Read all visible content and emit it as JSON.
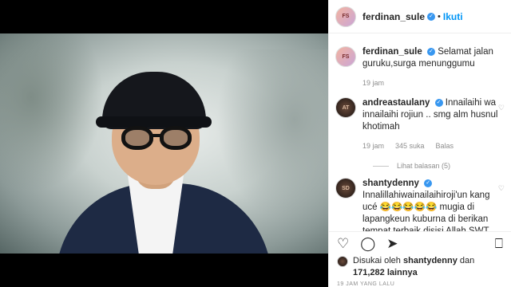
{
  "post_author": {
    "username": "ferdinan_sule",
    "follow_label": "Ikuti",
    "separator": "•",
    "avatar_icon": "avatar-ferdinan-sule"
  },
  "comments": [
    {
      "username": "ferdinan_sule",
      "text": "Selamat jalan guruku,surga menunggumu",
      "time": "19 jam",
      "likes": "",
      "reply": ""
    },
    {
      "username": "andreastaulany",
      "text": "Innailaihi wa innailaihi rojiun .. smg alm husnul khotimah",
      "time": "19 jam",
      "likes": "345 suka",
      "reply": "Balas",
      "view_replies": "Lihat balasan (5)"
    },
    {
      "username": "shantydenny",
      "text": "Innalillahiwainailaihiroji'un kang ucé 😂😂😂😂😂 mugia di lapangkeun kuburna di berikan tempat terbaik disisi Allah SWT , Aamiin 😇😇😇"
    }
  ],
  "actions": {
    "like_icon": "heart-icon",
    "comment_icon": "comment-icon",
    "share_icon": "send-icon",
    "save_icon": "bookmark-icon",
    "like": "♡",
    "comment": "◯",
    "share": "➤",
    "save": "⎕"
  },
  "likes": {
    "prefix": "Disukai oleh",
    "user": "shantydenny",
    "connector": "dan",
    "count": "171,282",
    "suffix": "lainnya"
  },
  "date": "19 JAM YANG LALU"
}
